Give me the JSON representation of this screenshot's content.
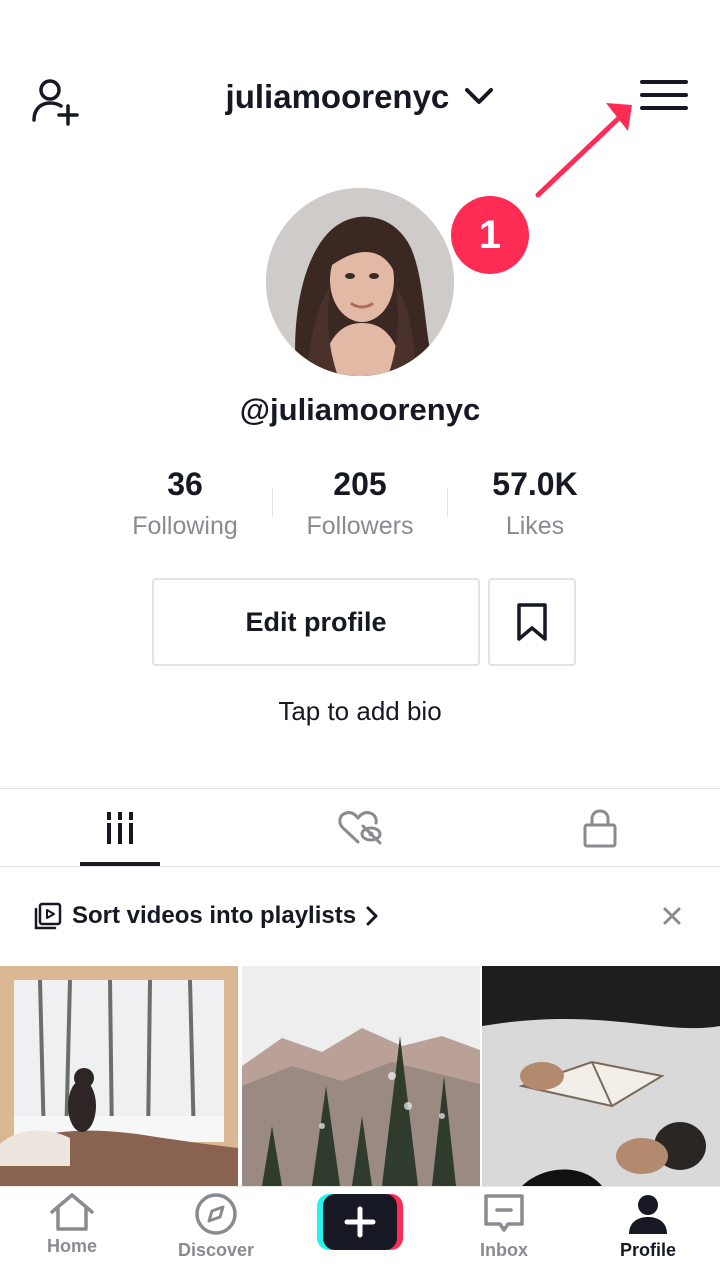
{
  "header": {
    "username": "juliamoorenyc",
    "add_friend_icon": "add-user-icon",
    "menu_icon": "hamburger-menu-icon"
  },
  "annotation": {
    "step_number": "1",
    "color": "#fe2c55"
  },
  "profile": {
    "handle": "@juliamoorenyc",
    "bio_placeholder": "Tap to add bio",
    "edit_button_label": "Edit profile",
    "bookmark_icon": "bookmark-icon"
  },
  "stats": [
    {
      "value": "36",
      "label": "Following"
    },
    {
      "value": "205",
      "label": "Followers"
    },
    {
      "value": "57.0K",
      "label": "Likes"
    }
  ],
  "tabs": [
    {
      "icon": "videos-grid-icon",
      "active": true
    },
    {
      "icon": "liked-hidden-icon",
      "active": false
    },
    {
      "icon": "lock-icon",
      "active": false
    }
  ],
  "playlist_prompt": {
    "label": "Sort videos into playlists",
    "close_icon": "close-icon"
  },
  "videos": [
    {
      "description": "cabin-snow"
    },
    {
      "description": "snowy-mountains"
    },
    {
      "description": "reading-coffee"
    }
  ],
  "bottom_nav": [
    {
      "label": "Home",
      "icon": "home-icon",
      "active": false
    },
    {
      "label": "Discover",
      "icon": "compass-icon",
      "active": false
    },
    {
      "label": "",
      "icon": "plus-icon",
      "active": false
    },
    {
      "label": "Inbox",
      "icon": "inbox-icon",
      "active": false
    },
    {
      "label": "Profile",
      "icon": "profile-icon",
      "active": true
    }
  ],
  "colors": {
    "text": "#161823",
    "secondary_text": "#8a8b91",
    "border": "#e3e3e4",
    "accent_red": "#fe2c55",
    "accent_cyan": "#25f4ee"
  }
}
